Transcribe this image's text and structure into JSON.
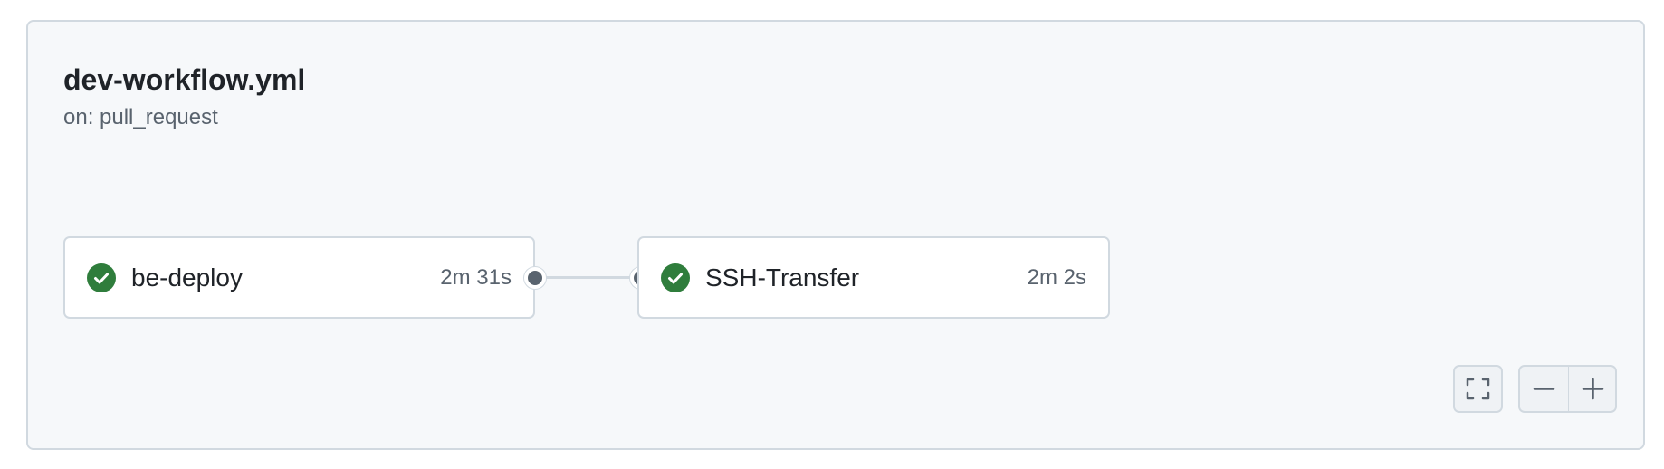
{
  "workflow": {
    "title": "dev-workflow.yml",
    "trigger": "on: pull_request"
  },
  "jobs": [
    {
      "name": "be-deploy",
      "duration": "2m 31s",
      "status": "success",
      "status_icon": "check-circle-icon"
    },
    {
      "name": "SSH-Transfer",
      "duration": "2m 2s",
      "status": "success",
      "status_icon": "check-circle-icon"
    }
  ],
  "controls": {
    "fit": {
      "icon": "fullscreen-icon"
    },
    "zoom_out": {
      "icon": "minus-icon"
    },
    "zoom_in": {
      "icon": "plus-icon"
    }
  },
  "colors": {
    "success": "#2f7d3c",
    "panel_bg": "#f6f8fa",
    "border": "#d1d9e0",
    "text_primary": "#1f2328",
    "text_muted": "#59636e"
  }
}
